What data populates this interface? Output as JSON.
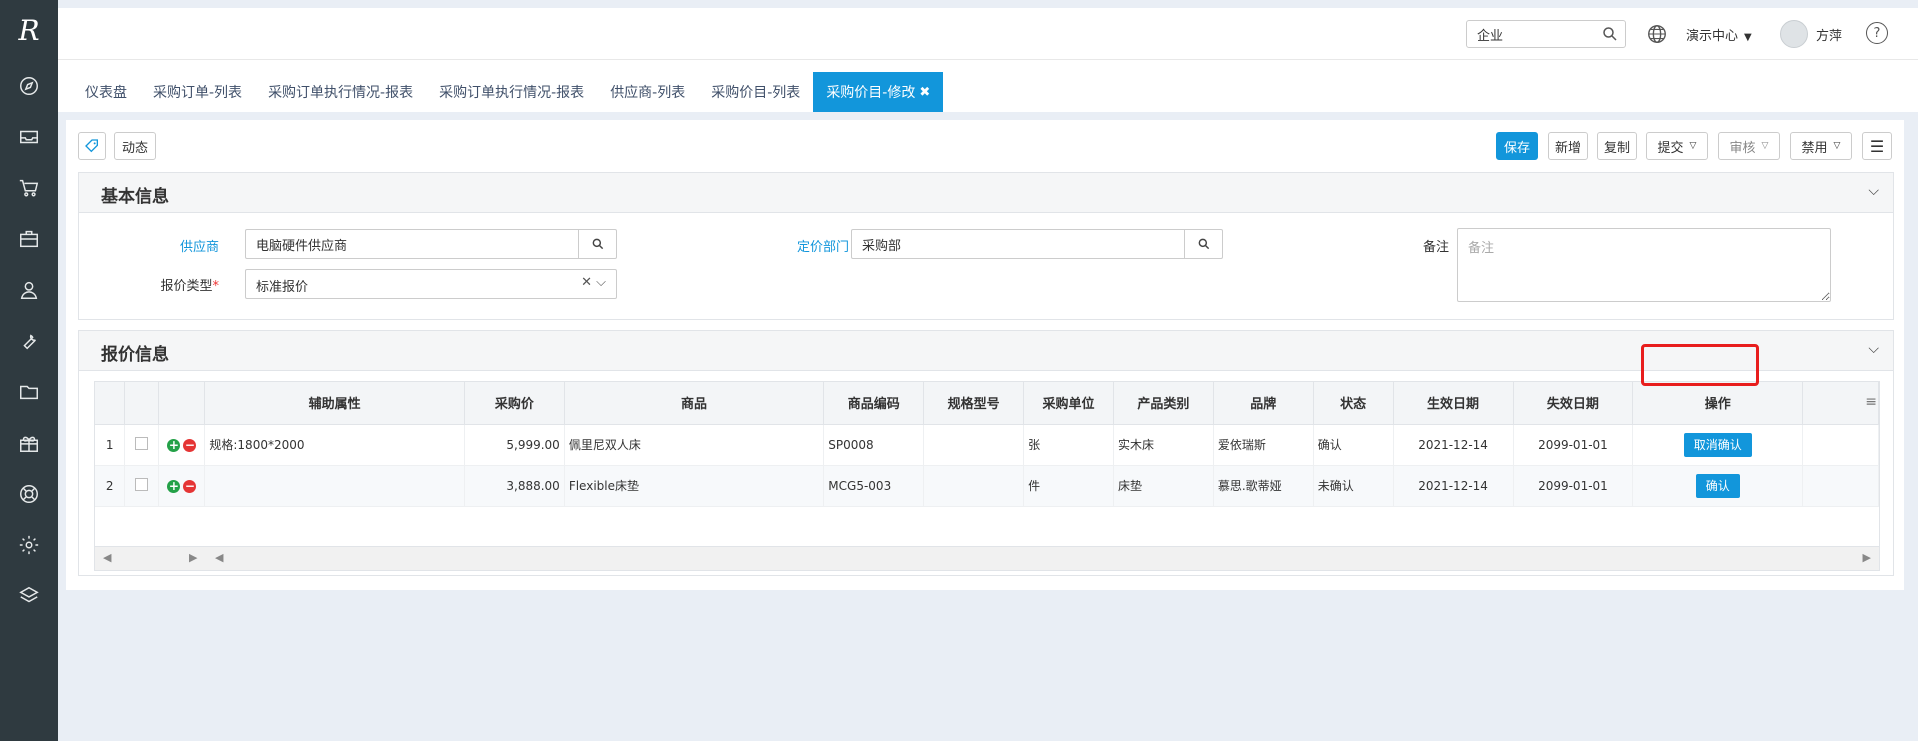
{
  "sidebar": {
    "logo": "R",
    "icons": [
      "compass-icon",
      "inbox-icon",
      "cart-icon",
      "briefcase-icon",
      "user-icon",
      "wrench-icon",
      "folder-icon",
      "gift-icon",
      "lifebuoy-icon",
      "gear-icon",
      "layers-icon"
    ]
  },
  "header": {
    "search_value": "企业",
    "org_label": "演示中心",
    "user_name": "方萍",
    "help_label": "?"
  },
  "tabs": [
    {
      "label": "仪表盘"
    },
    {
      "label": "采购订单-列表"
    },
    {
      "label": "采购订单执行情况-报表"
    },
    {
      "label": "采购订单执行情况-报表"
    },
    {
      "label": "供应商-列表"
    },
    {
      "label": "采购价目-列表"
    },
    {
      "label": "采购价目-修改",
      "active": true
    }
  ],
  "toolbar": {
    "activity_label": "动态",
    "save_label": "保存",
    "new_label": "新增",
    "copy_label": "复制",
    "submit_label": "提交",
    "audit_label": "审核",
    "disable_label": "禁用"
  },
  "basic_info": {
    "title": "基本信息",
    "supplier_label": "供应商",
    "supplier_value": "电脑硬件供应商",
    "dept_label": "定价部门",
    "dept_value": "采购部",
    "note_label": "备注",
    "note_placeholder": "备注",
    "quote_type_label": "报价类型",
    "quote_type_value": "标准报价"
  },
  "quote_info": {
    "title": "报价信息",
    "columns": [
      "辅助属性",
      "采购价",
      "商品",
      "商品编码",
      "规格型号",
      "采购单位",
      "产品类别",
      "品牌",
      "状态",
      "生效日期",
      "失效日期",
      "操作"
    ],
    "rows": [
      {
        "no": "1",
        "attr": "规格:1800*2000",
        "price": "5,999.00",
        "product": "佩里尼双人床",
        "code": "SP0008",
        "spec": "",
        "unit": "张",
        "category": "实木床",
        "brand": "爱依瑞斯",
        "status": "确认",
        "start": "2021-12-14",
        "end": "2099-01-01",
        "action": "取消确认"
      },
      {
        "no": "2",
        "attr": "",
        "price": "3,888.00",
        "product": "Flexible床垫",
        "code": "MCG5-003",
        "spec": "",
        "unit": "件",
        "category": "床垫",
        "brand": "慕思.歌蒂娅",
        "status": "未确认",
        "start": "2021-12-14",
        "end": "2099-01-01",
        "action": "确认"
      }
    ]
  },
  "colors": {
    "accent": "#1296db",
    "sidebar": "#2f3a40",
    "highlight": "#e81d1d"
  }
}
